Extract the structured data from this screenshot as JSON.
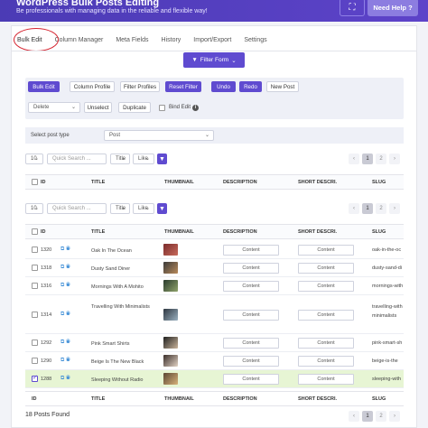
{
  "header": {
    "title": "WordPress Bulk Posts Editing",
    "subtitle": "Be professionals with managing data in the reliable and flexible way!",
    "help_label": "Need Help ?"
  },
  "tabs": [
    "Bulk Edit",
    "Column Manager",
    "Meta Fields",
    "History",
    "Import/Export",
    "Settings"
  ],
  "filter_form_label": "Filter Form",
  "toolbar": {
    "bulk_edit": "Bulk Edit",
    "column_profile": "Column Profile",
    "filter_profiles": "Filter Profiles",
    "reset_filter": "Reset Filter",
    "undo": "Undo",
    "redo": "Redo",
    "new_post": "New Post",
    "delete_select": "Delete",
    "unselect": "Unselect",
    "duplicate": "Duplicate",
    "bind_edit": "Bind Edit"
  },
  "post_type": {
    "label": "Select post type",
    "value": "Post"
  },
  "grid_controls": {
    "per_page": "10",
    "search_placeholder": "Quick Search ...",
    "field": "Title",
    "operator": "Like",
    "pages": [
      "1",
      "2"
    ]
  },
  "columns": [
    "ID",
    "TITLE",
    "THUMBNAIL",
    "DESCRIPTION",
    "SHORT DESCRI.",
    "SLUG"
  ],
  "content_label": "Content",
  "rows": [
    {
      "id": "1320",
      "title": "Oak In The Ocean",
      "slug": "oak-in-the-oc",
      "selected": false
    },
    {
      "id": "1318",
      "title": "Dusty Sand Diner",
      "slug": "dusty-sand-di",
      "selected": false
    },
    {
      "id": "1316",
      "title": "Mornings With A Mohito",
      "slug": "mornings-with",
      "selected": false
    },
    {
      "id": "1314",
      "title": "Travelling With Minimalists",
      "slug": "travelling-with minimalists",
      "selected": false
    },
    {
      "id": "1292",
      "title": "Pink Smart Shirts",
      "slug": "pink-smart-sh",
      "selected": false
    },
    {
      "id": "1290",
      "title": "Beige Is The New Black",
      "slug": "beige-is-the",
      "selected": false
    },
    {
      "id": "1288",
      "title": "Sleeping Without Radio",
      "slug": "sleeping-with",
      "selected": true
    }
  ],
  "footer": {
    "count": "18 Posts Found"
  },
  "colors": {
    "accent": "#5f4bd0",
    "header": "#4b3bb5",
    "selected_row": "#e7f5d4",
    "link_icon": "#3f8fd7"
  }
}
